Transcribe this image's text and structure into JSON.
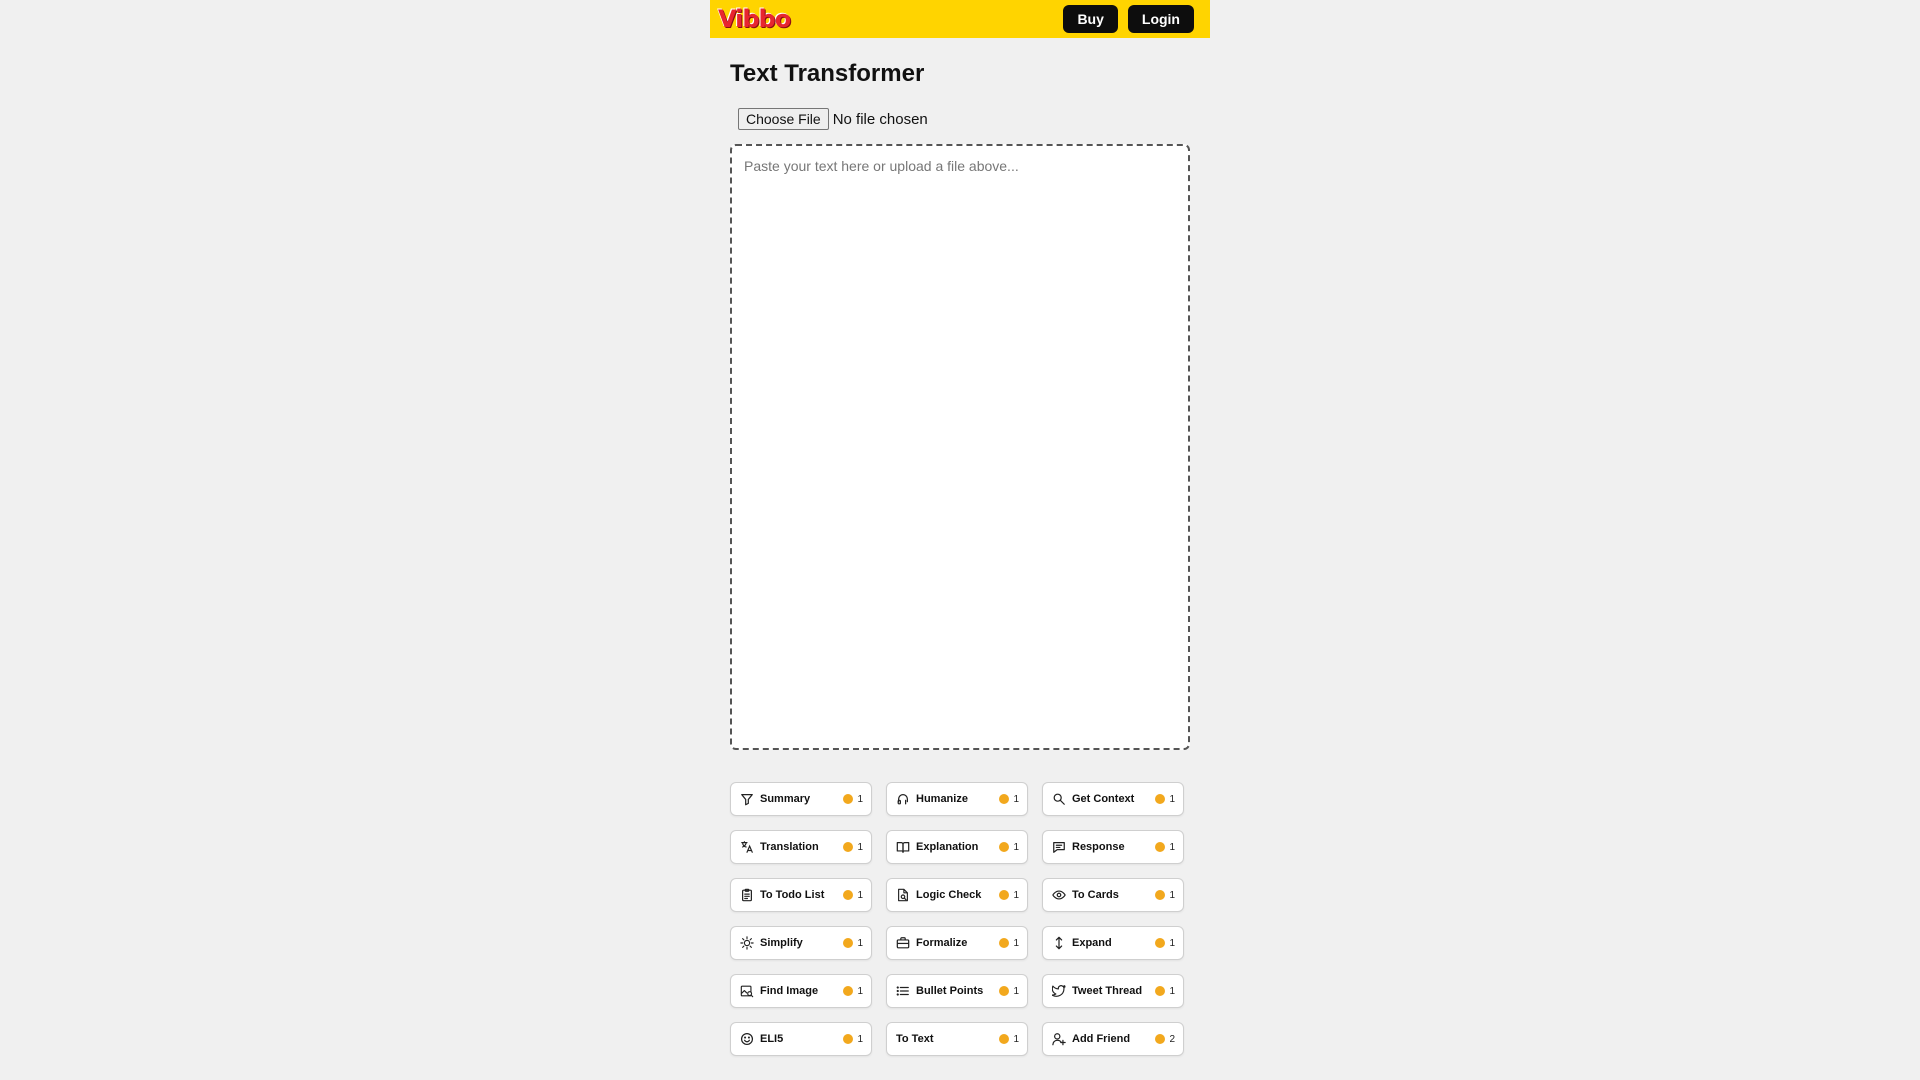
{
  "header": {
    "logo_text": "Vibbo",
    "buy_label": "Buy",
    "login_label": "Login",
    "brand_color": "#ffd400"
  },
  "main": {
    "title": "Text Transformer",
    "file_button_label": "Choose File",
    "file_status": "No file chosen",
    "textarea_placeholder": "Paste your text here or upload a file above..."
  },
  "tools": [
    {
      "label": "Summary",
      "icon": "filter-icon",
      "cost": "1"
    },
    {
      "label": "Humanize",
      "icon": "headphones-icon",
      "cost": "1"
    },
    {
      "label": "Get Context",
      "icon": "search-icon",
      "cost": "1"
    },
    {
      "label": "Translation",
      "icon": "translate-icon",
      "cost": "1"
    },
    {
      "label": "Explanation",
      "icon": "book-icon",
      "cost": "1"
    },
    {
      "label": "Response",
      "icon": "message-icon",
      "cost": "1"
    },
    {
      "label": "To Todo List",
      "icon": "clipboard-icon",
      "cost": "1"
    },
    {
      "label": "Logic Check",
      "icon": "document-search-icon",
      "cost": "1"
    },
    {
      "label": "To Cards",
      "icon": "eye-icon",
      "cost": "1"
    },
    {
      "label": "Simplify",
      "icon": "sun-icon",
      "cost": "1"
    },
    {
      "label": "Formalize",
      "icon": "briefcase-icon",
      "cost": "1"
    },
    {
      "label": "Expand",
      "icon": "arrows-vertical-icon",
      "cost": "1"
    },
    {
      "label": "Find Image",
      "icon": "image-search-icon",
      "cost": "1"
    },
    {
      "label": "Bullet Points",
      "icon": "list-icon",
      "cost": "1"
    },
    {
      "label": "Tweet Thread",
      "icon": "twitter-icon",
      "cost": "1"
    },
    {
      "label": "ELI5",
      "icon": "smile-icon",
      "cost": "1"
    },
    {
      "label": "To Text",
      "icon": "",
      "cost": "1"
    },
    {
      "label": "Add Friend",
      "icon": "user-plus-icon",
      "cost": "2"
    }
  ],
  "coin_color": "#f2a81d"
}
